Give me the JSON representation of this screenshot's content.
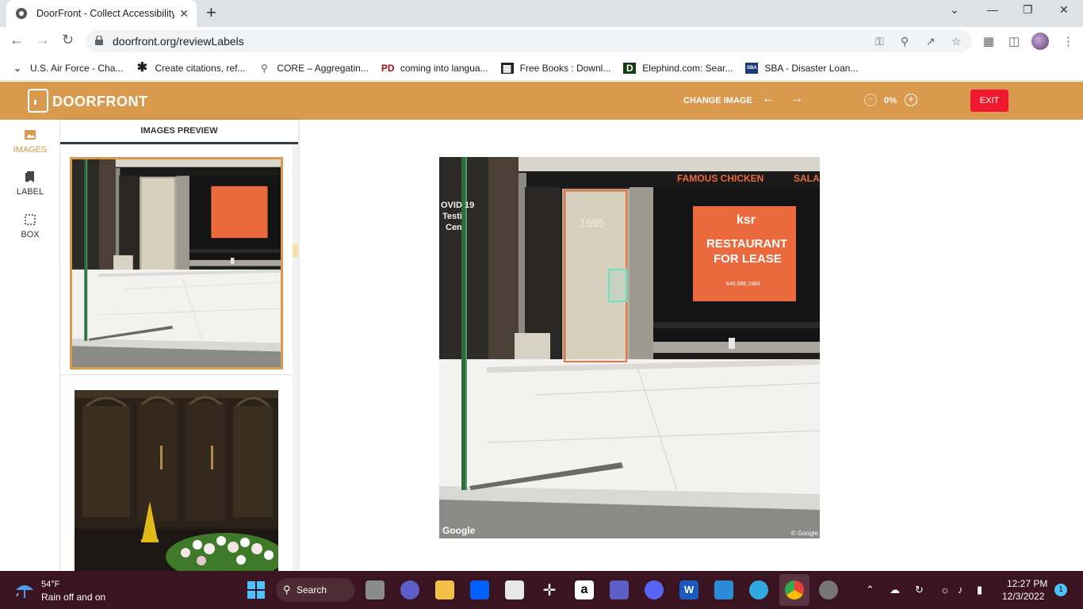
{
  "browser": {
    "tab_title": "DoorFront - Collect Accessibility I",
    "tab_close": "✕",
    "new_tab": "+",
    "url": "doorfront.org/reviewLabels",
    "window_controls": [
      "⌄",
      "—",
      "❐",
      "✕"
    ]
  },
  "bookmarks": [
    {
      "icon": "chevron-down-icon",
      "label": "U.S. Air Force - Cha..."
    },
    {
      "icon": "asterisk-icon",
      "label": "Create citations, ref..."
    },
    {
      "icon": "core-icon",
      "label": "CORE – Aggregatin..."
    },
    {
      "icon": "pd-icon",
      "label": "coming into langua..."
    },
    {
      "icon": "archive-icon",
      "label": "Free Books : Downl..."
    },
    {
      "icon": "elephind-icon",
      "label": "Elephind.com: Sear..."
    },
    {
      "icon": "sba-icon",
      "label": "SBA - Disaster Loan..."
    }
  ],
  "app": {
    "logo": "DOORFRONT",
    "change_image_label": "CHANGE IMAGE",
    "zoom_value": "0%",
    "exit_label": "EXIT",
    "header_color": "#d99a4e",
    "exit_color": "#f0182e"
  },
  "rail": {
    "items": [
      {
        "label": "IMAGES",
        "icon": "image-icon",
        "active": true
      },
      {
        "label": "LABEL",
        "icon": "bookmark-icon",
        "active": false
      },
      {
        "label": "BOX",
        "icon": "box-select-icon",
        "active": false
      }
    ]
  },
  "preview": {
    "header": "IMAGES PREVIEW"
  },
  "photo": {
    "store_sign": "FAMOUS CHICKEN",
    "sign_right": "SALA",
    "door_number": "1695",
    "lease_brand": "ksr",
    "lease_line1": "RESTAURANT",
    "lease_line2": "FOR LEASE",
    "lease_phone": "646.596.1884",
    "window_text": [
      "OVID 19",
      "Testi",
      "Cen"
    ],
    "watermark": "Google",
    "copyright": "© Google"
  },
  "taskbar": {
    "temp": "54°F",
    "weather": "Rain off and on",
    "search": "Search",
    "time": "12:27 PM",
    "date": "12/3/2022",
    "notifications": "1"
  }
}
